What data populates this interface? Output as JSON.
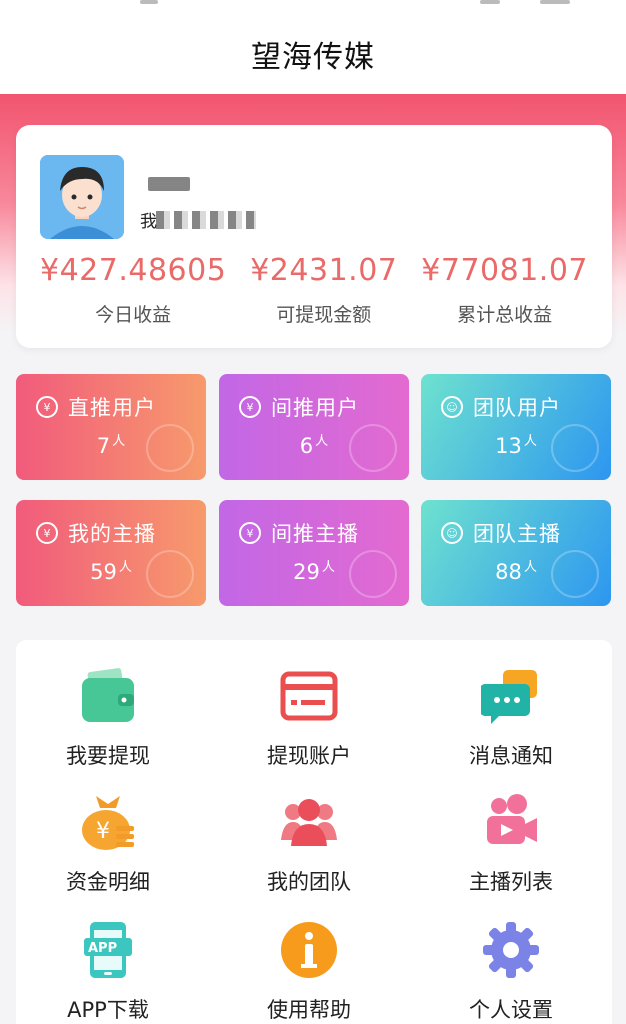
{
  "header": {
    "title": "望海传媒"
  },
  "profile": {
    "id_prefix": "我",
    "stats": [
      {
        "value": "¥427.48605",
        "label": "今日收益"
      },
      {
        "value": "¥2431.07",
        "label": "可提现金额"
      },
      {
        "value": "¥77081.07",
        "label": "累计总收益"
      }
    ]
  },
  "tiles": [
    {
      "label": "直推用户",
      "count": "7",
      "unit": "人",
      "icon": "money-bag-icon",
      "color": "red"
    },
    {
      "label": "间推用户",
      "count": "6",
      "unit": "人",
      "icon": "yen-plus-icon",
      "color": "purple"
    },
    {
      "label": "团队用户",
      "count": "13",
      "unit": "人",
      "icon": "team-icon",
      "color": "blue"
    },
    {
      "label": "我的主播",
      "count": "59",
      "unit": "人",
      "icon": "money-bag-icon",
      "color": "red"
    },
    {
      "label": "间推主播",
      "count": "29",
      "unit": "人",
      "icon": "yen-plus-icon",
      "color": "purple"
    },
    {
      "label": "团队主播",
      "count": "88",
      "unit": "人",
      "icon": "team-icon",
      "color": "blue"
    }
  ],
  "menu": [
    {
      "label": "我要提现",
      "icon": "wallet-icon"
    },
    {
      "label": "提现账户",
      "icon": "card-icon"
    },
    {
      "label": "消息通知",
      "icon": "message-icon"
    },
    {
      "label": "资金明细",
      "icon": "yen-bag-icon"
    },
    {
      "label": "我的团队",
      "icon": "group-icon"
    },
    {
      "label": "主播列表",
      "icon": "video-icon"
    },
    {
      "label": "APP下载",
      "icon": "app-download-icon"
    },
    {
      "label": "使用帮助",
      "icon": "info-icon"
    },
    {
      "label": "个人设置",
      "icon": "gear-icon"
    }
  ],
  "colors": {
    "accent": "#e96a68",
    "hero": "#f2546f"
  }
}
